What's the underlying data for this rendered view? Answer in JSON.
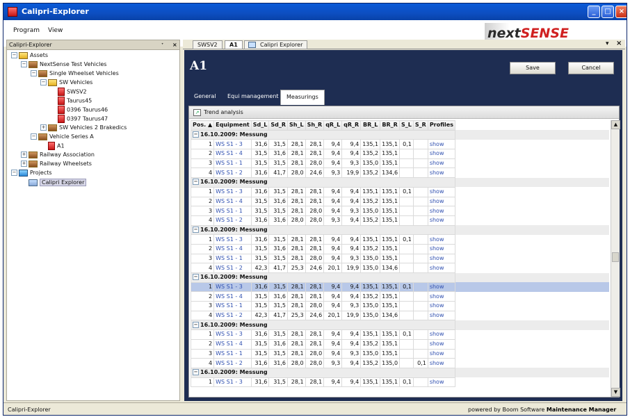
{
  "window": {
    "title": "Calipri-Explorer"
  },
  "menu": [
    "Program",
    "View"
  ],
  "logo": {
    "part1": "next",
    "part2": "SENSE"
  },
  "left_panel": {
    "title": "Calipri-Explorer",
    "tree": [
      {
        "label": "Assets",
        "depth": 0,
        "icon": "folder-yellow",
        "toggle": "−"
      },
      {
        "label": "NextSense Test Vehicles",
        "depth": 1,
        "icon": "folder-brown",
        "toggle": "−"
      },
      {
        "label": "Single Wheelset Vehicles",
        "depth": 2,
        "icon": "folder-brown",
        "toggle": "−"
      },
      {
        "label": "SW Vehicles",
        "depth": 3,
        "icon": "folder-yellow",
        "toggle": "−"
      },
      {
        "label": "SWSV2",
        "depth": 4,
        "icon": "vehicle-red",
        "toggle": ""
      },
      {
        "label": "Taurus45",
        "depth": 4,
        "icon": "vehicle-red",
        "toggle": ""
      },
      {
        "label": "0396 Taurus46",
        "depth": 4,
        "icon": "vehicle-red",
        "toggle": ""
      },
      {
        "label": "0397 Taurus47",
        "depth": 4,
        "icon": "vehicle-red",
        "toggle": ""
      },
      {
        "label": "SW Vehicles 2 Brakedics",
        "depth": 3,
        "icon": "folder-brown",
        "toggle": "+"
      },
      {
        "label": "Vehicle Series A",
        "depth": 2,
        "icon": "folder-brown",
        "toggle": "−"
      },
      {
        "label": "A1",
        "depth": 3,
        "icon": "vehicle-red",
        "toggle": ""
      },
      {
        "label": "Railway Association",
        "depth": 1,
        "icon": "folder-brown",
        "toggle": "+"
      },
      {
        "label": "Railway Wheelsets",
        "depth": 1,
        "icon": "folder-brown",
        "toggle": "+"
      },
      {
        "label": "Projects",
        "depth": 0,
        "icon": "folder-cyan",
        "toggle": "−"
      },
      {
        "label": "Calipri Explorer",
        "depth": 1,
        "icon": "project",
        "toggle": "",
        "selected": true
      }
    ]
  },
  "doc_tabs": [
    {
      "label": "SWSV2",
      "active": false
    },
    {
      "label": "A1",
      "active": true
    },
    {
      "label": "Calipri Explorer",
      "active": false
    }
  ],
  "page": {
    "title": "A1",
    "save_label": "Save",
    "cancel_label": "Cancel"
  },
  "inner_tabs": [
    {
      "label": "General",
      "active": false
    },
    {
      "label": "Equi management",
      "active": false
    },
    {
      "label": "Measurings",
      "active": true
    }
  ],
  "trend_analysis_label": "Trend analysis",
  "table": {
    "columns": [
      "Pos. ▲",
      "Equipment",
      "Sd_L",
      "Sd_R",
      "Sh_L",
      "Sh_R",
      "qR_L",
      "qR_R",
      "BR_L",
      "BR_R",
      "S_L",
      "S_R",
      "Profiles"
    ],
    "groups": [
      {
        "label": "16.10.2009: Messung",
        "rows": [
          [
            "1",
            "WS S1 - 3",
            "31,6",
            "31,5",
            "28,1",
            "28,1",
            "9,4",
            "9,4",
            "135,1",
            "135,1",
            "0,1",
            "",
            "show"
          ],
          [
            "2",
            "WS S1 - 4",
            "31,5",
            "31,6",
            "28,1",
            "28,1",
            "9,4",
            "9,4",
            "135,2",
            "135,1",
            "",
            "",
            "show"
          ],
          [
            "3",
            "WS S1 - 1",
            "31,5",
            "31,5",
            "28,1",
            "28,0",
            "9,4",
            "9,3",
            "135,0",
            "135,1",
            "",
            "",
            "show"
          ],
          [
            "4",
            "WS S1 - 2",
            "31,6",
            "41,7",
            "28,0",
            "24,6",
            "9,3",
            "19,9",
            "135,2",
            "134,6",
            "",
            "",
            "show"
          ]
        ]
      },
      {
        "label": "16.10.2009: Messung",
        "rows": [
          [
            "1",
            "WS S1 - 3",
            "31,6",
            "31,5",
            "28,1",
            "28,1",
            "9,4",
            "9,4",
            "135,1",
            "135,1",
            "0,1",
            "",
            "show"
          ],
          [
            "2",
            "WS S1 - 4",
            "31,5",
            "31,6",
            "28,1",
            "28,1",
            "9,4",
            "9,4",
            "135,2",
            "135,1",
            "",
            "",
            "show"
          ],
          [
            "3",
            "WS S1 - 1",
            "31,5",
            "31,5",
            "28,1",
            "28,0",
            "9,4",
            "9,3",
            "135,0",
            "135,1",
            "",
            "",
            "show"
          ],
          [
            "4",
            "WS S1 - 2",
            "31,6",
            "31,6",
            "28,0",
            "28,0",
            "9,3",
            "9,4",
            "135,2",
            "135,1",
            "",
            "",
            "show"
          ]
        ]
      },
      {
        "label": "16.10.2009: Messung",
        "rows": [
          [
            "1",
            "WS S1 - 3",
            "31,6",
            "31,5",
            "28,1",
            "28,1",
            "9,4",
            "9,4",
            "135,1",
            "135,1",
            "0,1",
            "",
            "show"
          ],
          [
            "2",
            "WS S1 - 4",
            "31,5",
            "31,6",
            "28,1",
            "28,1",
            "9,4",
            "9,4",
            "135,2",
            "135,1",
            "",
            "",
            "show"
          ],
          [
            "3",
            "WS S1 - 1",
            "31,5",
            "31,5",
            "28,1",
            "28,0",
            "9,4",
            "9,3",
            "135,0",
            "135,1",
            "",
            "",
            "show"
          ],
          [
            "4",
            "WS S1 - 2",
            "42,3",
            "41,7",
            "25,3",
            "24,6",
            "20,1",
            "19,9",
            "135,0",
            "134,6",
            "",
            "",
            "show"
          ]
        ]
      },
      {
        "label": "16.10.2009: Messung",
        "rows": [
          [
            "1",
            "WS S1 - 3",
            "31,6",
            "31,5",
            "28,1",
            "28,1",
            "9,4",
            "9,4",
            "135,1",
            "135,1",
            "0,1",
            "",
            "show"
          ],
          [
            "2",
            "WS S1 - 4",
            "31,5",
            "31,6",
            "28,1",
            "28,1",
            "9,4",
            "9,4",
            "135,2",
            "135,1",
            "",
            "",
            "show"
          ],
          [
            "3",
            "WS S1 - 1",
            "31,5",
            "31,5",
            "28,1",
            "28,0",
            "9,4",
            "9,3",
            "135,0",
            "135,1",
            "",
            "",
            "show"
          ],
          [
            "4",
            "WS S1 - 2",
            "42,3",
            "41,7",
            "25,3",
            "24,6",
            "20,1",
            "19,9",
            "135,0",
            "134,6",
            "",
            "",
            "show"
          ]
        ]
      },
      {
        "label": "16.10.2009: Messung",
        "rows": [
          [
            "1",
            "WS S1 - 3",
            "31,6",
            "31,5",
            "28,1",
            "28,1",
            "9,4",
            "9,4",
            "135,1",
            "135,1",
            "0,1",
            "",
            "show"
          ],
          [
            "2",
            "WS S1 - 4",
            "31,5",
            "31,6",
            "28,1",
            "28,1",
            "9,4",
            "9,4",
            "135,2",
            "135,1",
            "",
            "",
            "show"
          ],
          [
            "3",
            "WS S1 - 1",
            "31,5",
            "31,5",
            "28,1",
            "28,0",
            "9,4",
            "9,3",
            "135,0",
            "135,1",
            "",
            "",
            "show"
          ],
          [
            "4",
            "WS S1 - 2",
            "31,6",
            "31,6",
            "28,0",
            "28,0",
            "9,3",
            "9,4",
            "135,2",
            "135,0",
            "",
            "0,1",
            "show"
          ]
        ]
      },
      {
        "label": "16.10.2009: Messung",
        "rows": [
          [
            "1",
            "WS S1 - 3",
            "31,6",
            "31,5",
            "28,1",
            "28,1",
            "9,4",
            "9,4",
            "135,1",
            "135,1",
            "0,1",
            "",
            "show"
          ]
        ]
      }
    ],
    "selected": {
      "group": 3,
      "row": 0
    }
  },
  "status": {
    "left": "Calipri-Explorer",
    "right_prefix": "powered by Boom Software ",
    "right_bold": "Maintenance Manager"
  },
  "colors": {
    "accent_dark": "#1e2d52",
    "selection": "#b8c8e8",
    "link": "#3050b0",
    "logo_red": "#d02020"
  }
}
